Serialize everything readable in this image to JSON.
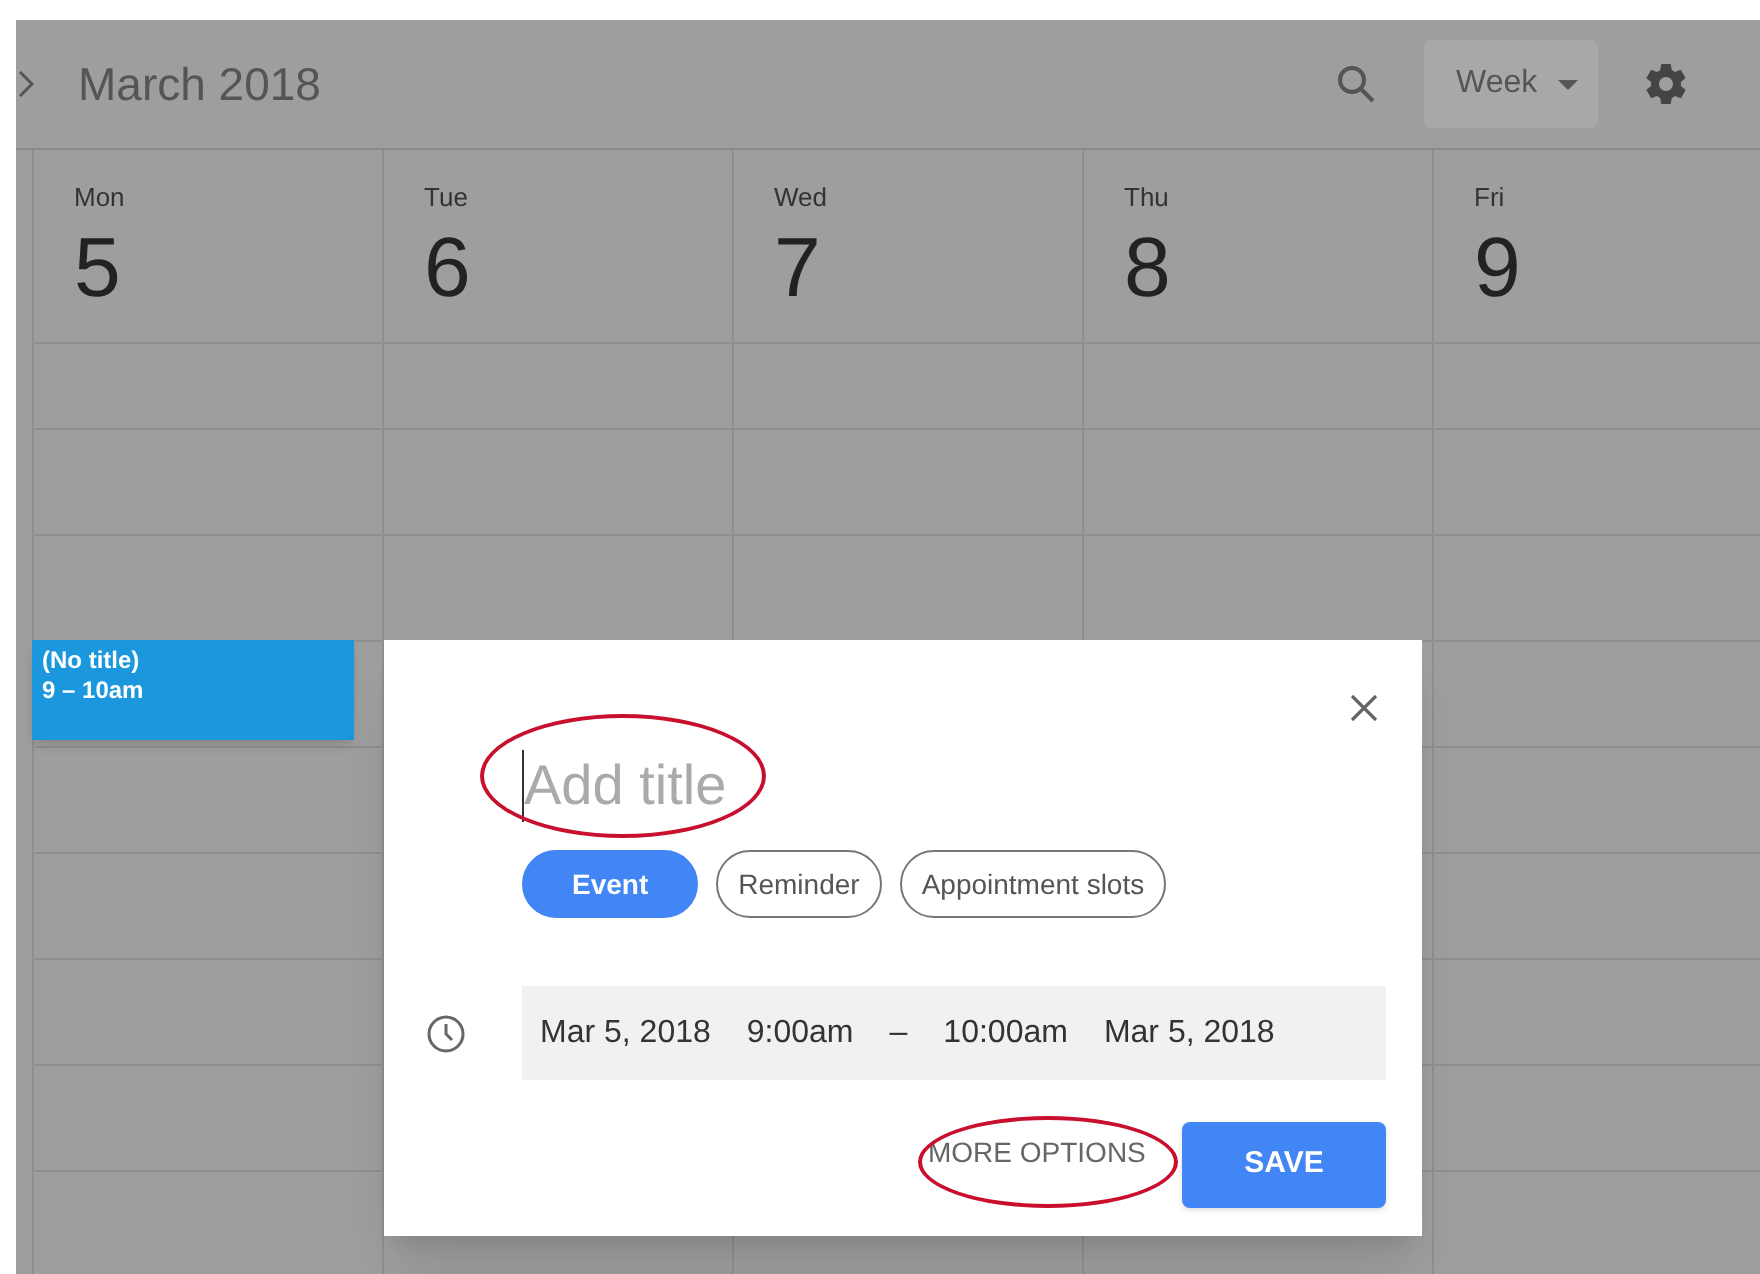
{
  "header": {
    "title": "March 2018",
    "view": "Week"
  },
  "days": [
    {
      "weekday": "Mon",
      "date": "5"
    },
    {
      "weekday": "Tue",
      "date": "6"
    },
    {
      "weekday": "Wed",
      "date": "7"
    },
    {
      "weekday": "Thu",
      "date": "8"
    },
    {
      "weekday": "Fri",
      "date": "9"
    }
  ],
  "events": [
    {
      "title": "(No title)",
      "time": "9 – 10am"
    }
  ],
  "dialog": {
    "title_placeholder": "Add title",
    "types": [
      {
        "label": "Event",
        "selected": true
      },
      {
        "label": "Reminder",
        "selected": false
      },
      {
        "label": "Appointment slots",
        "selected": false
      }
    ],
    "time_row": [
      "Mar 5, 2018",
      "9:00am",
      "–",
      "10:00am",
      "Mar 5, 2018"
    ],
    "more_button": "MORE OPTIONS",
    "save_button": "SAVE"
  }
}
